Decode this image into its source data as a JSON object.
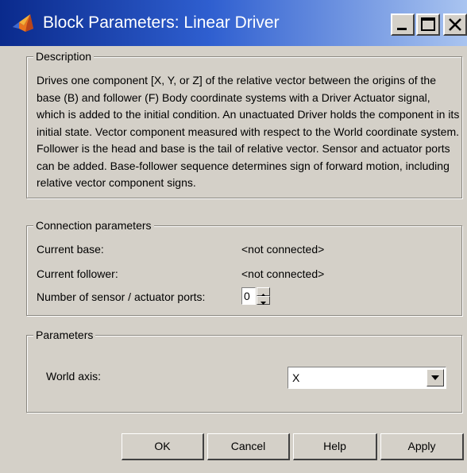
{
  "window": {
    "title": "Block Parameters: Linear Driver",
    "icon": "matlab-icon",
    "controls": [
      "minimize-icon",
      "maximize-icon",
      "close-icon"
    ]
  },
  "description": {
    "legend": "Description",
    "text": "Drives one component [X, Y, or Z] of the relative vector between the origins of the base (B) and follower (F) Body coordinate systems with a Driver Actuator signal, which is added to the initial condition. An unactuated Driver holds the component in its initial state. Vector component measured with respect to the World coordinate system. Follower is the head and base is the tail of relative vector. Sensor and actuator ports can be added. Base-follower sequence determines sign of forward motion, including relative vector component signs."
  },
  "connection": {
    "legend": "Connection parameters",
    "current_base_label": "Current base:",
    "current_base_value": "<not connected>",
    "current_follower_label": "Current follower:",
    "current_follower_value": "<not connected>",
    "ports_label": "Number of sensor / actuator ports:",
    "ports_value": "0"
  },
  "parameters": {
    "legend": "Parameters",
    "world_axis_label": "World axis:",
    "world_axis_value": "X"
  },
  "buttons": {
    "ok": "OK",
    "cancel": "Cancel",
    "help": "Help",
    "apply": "Apply"
  }
}
